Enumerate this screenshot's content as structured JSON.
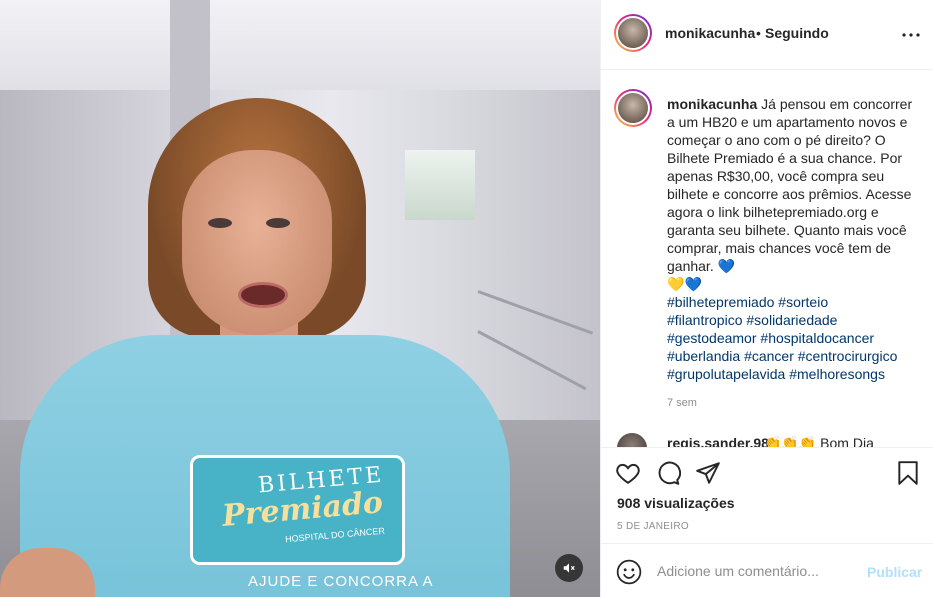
{
  "media": {
    "mute_icon": "speaker-muted-icon",
    "shirt_logo": [
      "BILHETE",
      "Premiado",
      "HOSPITAL DO CÂNCER"
    ],
    "shirt_footer": "AJUDE E CONCORRA A"
  },
  "header": {
    "username": "monikacunha",
    "separator": "•",
    "follow_status": "Seguindo",
    "more_icon": "ellipsis-icon"
  },
  "caption": {
    "username": "monikacunha",
    "text": "Já pensou em concorrer a um HB20 e um apartamento novos e começar o ano com o pé direito? O Bilhete Premiado é a sua chance. Por apenas R$30,00, você compra seu bilhete e concorre aos prêmios. Acesse agora o link bilhetepremiado.org e garanta seu bilhete. Quanto mais você comprar, mais chances você tem de ganhar.",
    "emoji": [
      "💙",
      "💛",
      "💙"
    ],
    "hashtags": [
      "#bilhetepremiado",
      "#sorteio",
      "#filantropico",
      "#solidariedade",
      "#gestodeamor",
      "#hospitaldocancer",
      "#uberlandia",
      "#cancer",
      "#centrocirurgico",
      "#grupolutapelavida",
      "#melhoresongs"
    ],
    "time_ago": "7 sem"
  },
  "comment": {
    "username": "regis.sander.98",
    "text": "👏👏👏 Bom Dia"
  },
  "actions": {
    "like_icon": "heart-icon",
    "comment_icon": "comment-bubble-icon",
    "share_icon": "paper-plane-icon",
    "save_icon": "bookmark-icon",
    "views": "908 visualizações",
    "date": "5 DE JANEIRO"
  },
  "add_comment": {
    "emoji_icon": "smiley-icon",
    "placeholder": "Adicione um comentário...",
    "publish_label": "Publicar",
    "publish_color": "#b2dffc"
  }
}
